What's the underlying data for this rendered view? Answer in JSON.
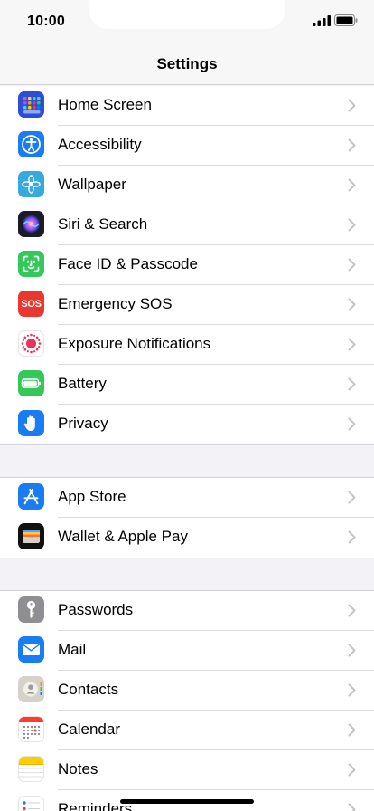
{
  "status": {
    "time": "10:00"
  },
  "nav": {
    "title": "Settings"
  },
  "groups": [
    {
      "items": [
        {
          "label": "Home Screen",
          "icon": "home-screen-icon",
          "color": "#2a4fd6"
        },
        {
          "label": "Accessibility",
          "icon": "accessibility-icon",
          "color": "#1a7cf3"
        },
        {
          "label": "Wallpaper",
          "icon": "wallpaper-icon",
          "color": "#36a9dd"
        },
        {
          "label": "Siri & Search",
          "icon": "siri-icon",
          "color": "#1b1b2e"
        },
        {
          "label": "Face ID & Passcode",
          "icon": "face-id-icon",
          "color": "#34c759"
        },
        {
          "label": "Emergency SOS",
          "icon": "sos-icon",
          "color": "#e8382f",
          "icon_text": "SOS"
        },
        {
          "label": "Exposure Notifications",
          "icon": "exposure-notifications-icon",
          "color": "#ffffff"
        },
        {
          "label": "Battery",
          "icon": "battery-icon",
          "color": "#34c759"
        },
        {
          "label": "Privacy",
          "icon": "privacy-hand-icon",
          "color": "#1a7cf3"
        }
      ]
    },
    {
      "items": [
        {
          "label": "App Store",
          "icon": "app-store-icon",
          "color": "#1a7cf3"
        },
        {
          "label": "Wallet & Apple Pay",
          "icon": "wallet-icon",
          "color": "#111111"
        }
      ]
    },
    {
      "items": [
        {
          "label": "Passwords",
          "icon": "key-icon",
          "color": "#8e8e93"
        },
        {
          "label": "Mail",
          "icon": "mail-icon",
          "color": "#1a7cf3"
        },
        {
          "label": "Contacts",
          "icon": "contacts-icon",
          "color": "#c9c5bd"
        },
        {
          "label": "Calendar",
          "icon": "calendar-icon",
          "color": "#ffffff"
        },
        {
          "label": "Notes",
          "icon": "notes-icon",
          "color": "#ffffff"
        },
        {
          "label": "Reminders",
          "icon": "reminders-icon",
          "color": "#ffffff"
        }
      ]
    }
  ]
}
